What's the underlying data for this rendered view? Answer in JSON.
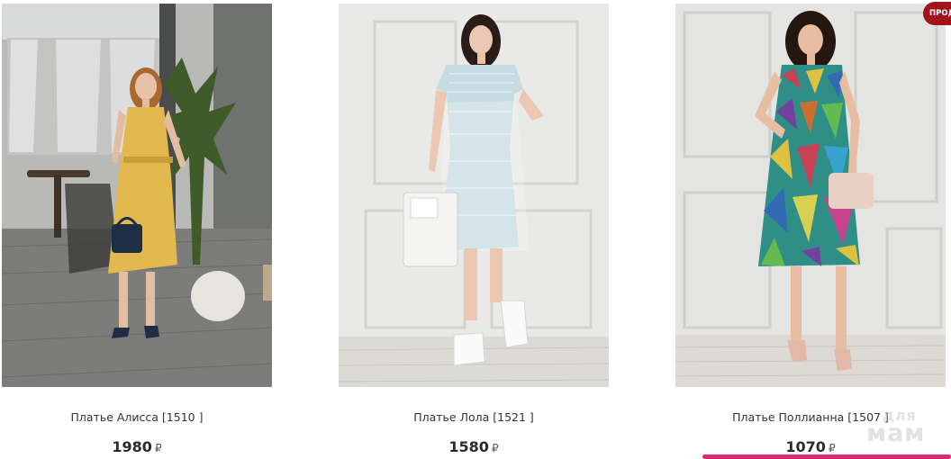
{
  "products": [
    {
      "title": "Платье Алисса [1510 ]",
      "price": "1980",
      "currency": "₽",
      "image": "yellow-dress-photo"
    },
    {
      "title": "Платье Лола [1521 ]",
      "price": "1580",
      "currency": "₽",
      "image": "light-blue-tulle-dress-photo"
    },
    {
      "title": "Платье Поллианна [1507 ]",
      "price": "1070",
      "currency": "₽",
      "image": "geometric-print-dress-photo"
    }
  ],
  "sale_badge": "ПРОД",
  "watermark": {
    "line1": "для",
    "line2": "мам"
  },
  "colors": {
    "accent": "#e02a6f",
    "badge": "#a0141c"
  }
}
